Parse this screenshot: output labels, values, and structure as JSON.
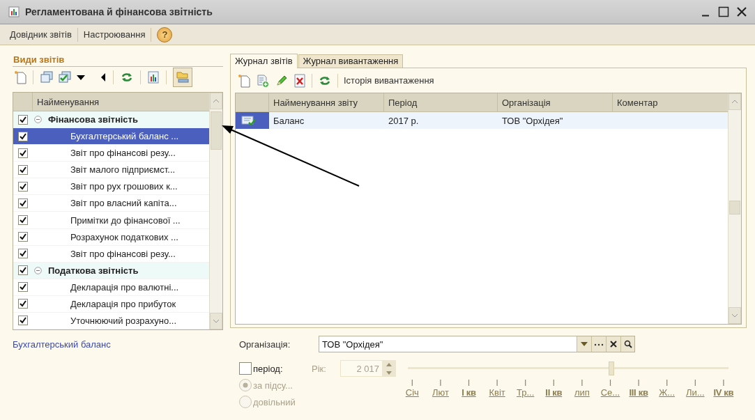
{
  "window": {
    "title": "Регламентована й фінансова звітність"
  },
  "menu": {
    "items": [
      "Довідник звітів",
      "Настроювання"
    ],
    "help": "?"
  },
  "report_types": {
    "title": "Види звітів",
    "column": "Найменування",
    "items": [
      {
        "label": "Фінансова звітність",
        "checked": true,
        "expanded": true,
        "selected": false,
        "children": [
          {
            "label": "Бухгалтерський баланс ...",
            "checked": true,
            "selected": true
          },
          {
            "label": "Звіт про фінансові резу...",
            "checked": true,
            "selected": false
          },
          {
            "label": "Звіт малого підприємст...",
            "checked": true,
            "selected": false
          },
          {
            "label": "Звіт про рух грошових к...",
            "checked": true,
            "selected": false
          },
          {
            "label": "Звіт про власний капіта...",
            "checked": true,
            "selected": false
          },
          {
            "label": "Примітки до фінансової ...",
            "checked": true,
            "selected": false
          },
          {
            "label": "Розрахунок податкових ...",
            "checked": true,
            "selected": false
          },
          {
            "label": "Звіт про фінансові резу...",
            "checked": true,
            "selected": false
          }
        ]
      },
      {
        "label": "Податкова звітність",
        "checked": true,
        "expanded": true,
        "selected": false,
        "children": [
          {
            "label": "Декларація про валютні...",
            "checked": true,
            "selected": false
          },
          {
            "label": "Декларація про прибуток",
            "checked": true,
            "selected": false
          },
          {
            "label": "Уточнюючий розрахуно...",
            "checked": true,
            "selected": false
          }
        ]
      }
    ]
  },
  "selected_report_link": "Бухгалтерський баланс",
  "tabs": [
    {
      "label": "Журнал звітів",
      "selected": true
    },
    {
      "label": "Журнал вивантаження",
      "selected": false
    }
  ],
  "journal": {
    "history_button": "Історія вивантаження",
    "columns": [
      "Найменування звіту",
      "Період",
      "Організація",
      "Коментар"
    ],
    "rows": [
      {
        "cells": [
          "Баланс",
          "2017 р.",
          "ТОВ \"Орхідея\""
        ],
        "selected": true
      }
    ]
  },
  "filter": {
    "organization_label": "Організація:",
    "organization": "ТОВ \"Орхідея\"",
    "period": {
      "label": "період:",
      "checked": false
    },
    "year": {
      "label": "Рік:",
      "value": "2 017",
      "disabled": true
    },
    "modes": [
      {
        "label": "за підсу...",
        "selected": true,
        "disabled": true
      },
      {
        "label": "довільний",
        "selected": false,
        "disabled": true
      }
    ],
    "slider": {
      "level": 0.635
    },
    "periods": [
      {
        "label": "Січ",
        "kind": "month"
      },
      {
        "label": "Лют",
        "kind": "month"
      },
      {
        "label": "I кв",
        "kind": "quarter"
      },
      {
        "label": "Квіт",
        "kind": "month"
      },
      {
        "label": "Тр...",
        "kind": "month"
      },
      {
        "label": "II кв",
        "kind": "quarter"
      },
      {
        "label": "лип",
        "kind": "month"
      },
      {
        "label": "Се...",
        "kind": "month"
      },
      {
        "label": "III кв",
        "kind": "quarter"
      },
      {
        "label": "Ж...",
        "kind": "month"
      },
      {
        "label": "Ли...",
        "kind": "month"
      },
      {
        "label": "IV кв",
        "kind": "quarter"
      }
    ]
  }
}
